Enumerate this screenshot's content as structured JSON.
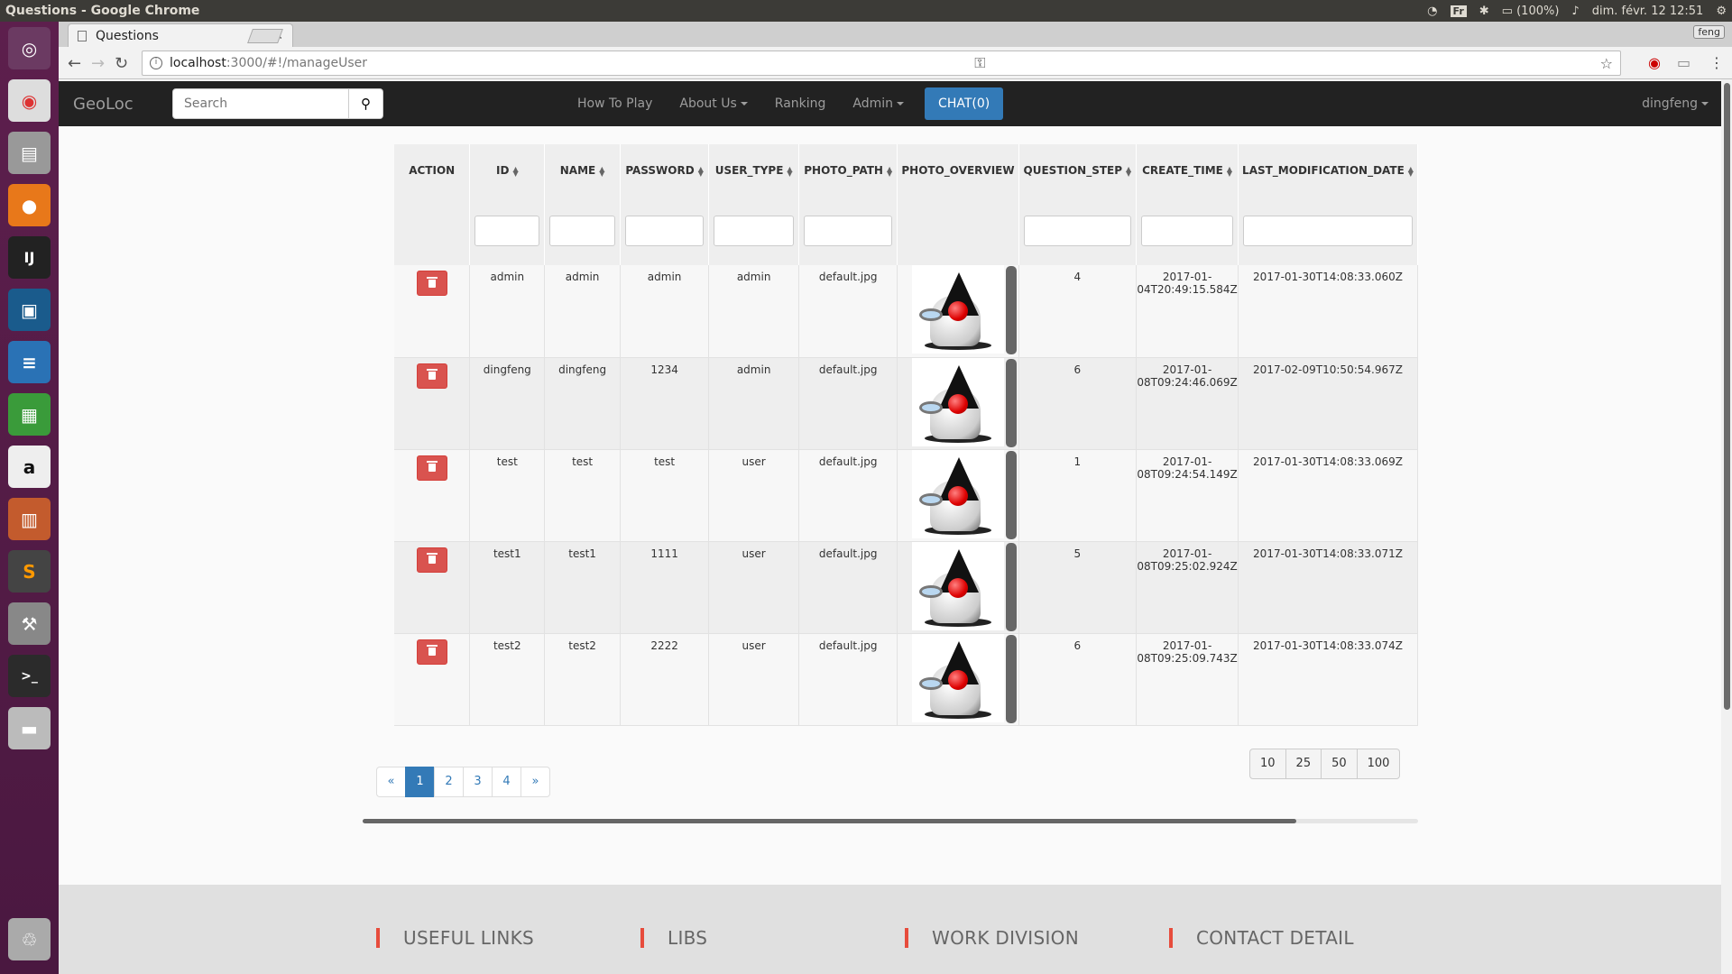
{
  "os": {
    "window_title": "Questions - Google Chrome",
    "keyboard": "Fr",
    "battery": "(100%)",
    "datetime": "dim. févr. 12 12:51"
  },
  "browser": {
    "tab_title": "Questions",
    "profile": "feng",
    "url_host": "localhost",
    "url_path": ":3000/#!/manageUser"
  },
  "navbar": {
    "brand": "GeoLoc",
    "search_placeholder": "Search",
    "links": [
      "How To Play",
      "About Us",
      "Ranking",
      "Admin"
    ],
    "chat": "CHAT(0)",
    "user": "dingfeng"
  },
  "table": {
    "columns": [
      "ACTION",
      "ID",
      "NAME",
      "PASSWORD",
      "USER_TYPE",
      "PHOTO_PATH",
      "PHOTO_OVERVIEW",
      "QUESTION_STEP",
      "CREATE_TIME",
      "LAST_MODIFICATION_DATE"
    ],
    "rows": [
      {
        "id": "admin",
        "name": "admin",
        "password": "admin",
        "user_type": "admin",
        "photo_path": "default.jpg",
        "question_step": "4",
        "create_time_1": "2017-01-",
        "create_time_2": "04T20:49:15.584Z",
        "last_mod": "2017-01-30T14:08:33.060Z"
      },
      {
        "id": "dingfeng",
        "name": "dingfeng",
        "password": "1234",
        "user_type": "admin",
        "photo_path": "default.jpg",
        "question_step": "6",
        "create_time_1": "2017-01-",
        "create_time_2": "08T09:24:46.069Z",
        "last_mod": "2017-02-09T10:50:54.967Z"
      },
      {
        "id": "test",
        "name": "test",
        "password": "test",
        "user_type": "user",
        "photo_path": "default.jpg",
        "question_step": "1",
        "create_time_1": "2017-01-",
        "create_time_2": "08T09:24:54.149Z",
        "last_mod": "2017-01-30T14:08:33.069Z"
      },
      {
        "id": "test1",
        "name": "test1",
        "password": "1111",
        "user_type": "user",
        "photo_path": "default.jpg",
        "question_step": "5",
        "create_time_1": "2017-01-",
        "create_time_2": "08T09:25:02.924Z",
        "last_mod": "2017-01-30T14:08:33.071Z"
      },
      {
        "id": "test2",
        "name": "test2",
        "password": "2222",
        "user_type": "user",
        "photo_path": "default.jpg",
        "question_step": "6",
        "create_time_1": "2017-01-",
        "create_time_2": "08T09:25:09.743Z",
        "last_mod": "2017-01-30T14:08:33.074Z"
      }
    ]
  },
  "pagination": {
    "prev": "«",
    "pages": [
      "1",
      "2",
      "3",
      "4"
    ],
    "next": "»",
    "active_page": "1"
  },
  "page_sizes": [
    "10",
    "25",
    "50",
    "100"
  ],
  "footer": {
    "sections": [
      "USEFUL LINKS",
      "LIBS",
      "WORK DIVISION",
      "CONTACT DETAIL"
    ]
  },
  "colors": {
    "navbar": "#222222",
    "primary": "#337ab7",
    "danger": "#d9534f",
    "footer_accent": "#e74c3c"
  }
}
